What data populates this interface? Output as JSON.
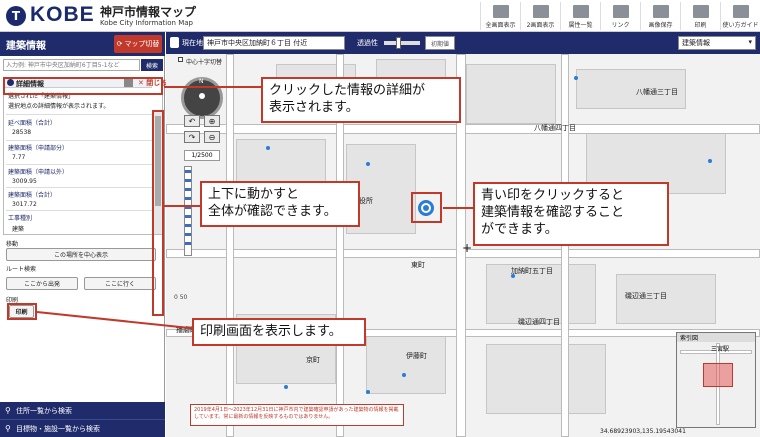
{
  "header": {
    "logo_mark": "T",
    "logo_text": "KOBE",
    "site_title": "神戸市情報マップ",
    "site_subtitle": "Kobe City Information Map",
    "tools": [
      {
        "label": "全画面表示",
        "icon": "fullscreen-icon"
      },
      {
        "label": "2画面表示",
        "icon": "split-screen-icon"
      },
      {
        "label": "属性一覧",
        "icon": "list-icon"
      },
      {
        "label": "リンク",
        "icon": "link-icon"
      },
      {
        "label": "画像保存",
        "icon": "save-image-icon"
      },
      {
        "label": "印刷",
        "icon": "print-icon"
      },
      {
        "label": "使い方ガイド",
        "icon": "guide-icon"
      }
    ]
  },
  "panel": {
    "title": "建築情報",
    "map_toggle": "マップ切替",
    "search_placeholder": "入力例: 神戸市中央区加納町6丁目5-1など",
    "search_button": "検索",
    "detail": {
      "title": "詳細情報",
      "close": "✕ 閉じる",
      "lines": [
        "選択された「建築情報」",
        "選択地点の詳細情報が表示されます。"
      ],
      "fields": [
        {
          "label": "延べ面積（合計）",
          "value": "28538"
        },
        {
          "label": "建築面積（申請部分）",
          "value": "7.77"
        },
        {
          "label": "建築面積（申請以外）",
          "value": "3009.95"
        },
        {
          "label": "建築面積（合計）",
          "value": "3017.72"
        },
        {
          "label": "工事種別",
          "value": "建築"
        }
      ]
    },
    "move_label": "移動",
    "center_button": "この場所を中心表示",
    "route_label": "ルート検索",
    "from_button": "ここから出発",
    "to_button": "ここに行く",
    "print_label": "印刷",
    "print_button": "印刷",
    "nav_address": "住所一覧から検索",
    "nav_landmark": "目標物・施設一覧から検索"
  },
  "map_toolbar": {
    "current_label": "現在地",
    "address_value": "神戸市中央区加納町６丁目 付近",
    "opacity_label": "透過性",
    "opacity_button": "初期値",
    "layer_selected": "建築情報"
  },
  "map": {
    "cross_label": "中心十字切替",
    "scale": "1/2500",
    "labels": [
      "八幡通三丁目",
      "八幡通四丁目",
      "加納町五丁目",
      "磯辺通三丁目",
      "磯辺通四丁目",
      "東町",
      "伊藤町",
      "播磨町",
      "京町",
      "神戸市役所",
      "三宮駅",
      "神戸市役所"
    ],
    "notice": "2019年4月1日〜2023年12月31日に神戸市内で建築確認申請があった建築物の情報を掲載しています。常に最新の情報を反映するものではありません。",
    "coords": "34.68923903,135.19543041",
    "minimap_title": "索引図",
    "minimap_label": "三宮駅"
  },
  "annotations": {
    "detail": "クリックした情報の詳細が\n表示されます。",
    "scroll": "上下に動かすと\n全体が確認できます。",
    "marker": "青い印をクリックすると\n建築情報を確認すること\nができます。",
    "print": "印刷画面を表示します。"
  }
}
